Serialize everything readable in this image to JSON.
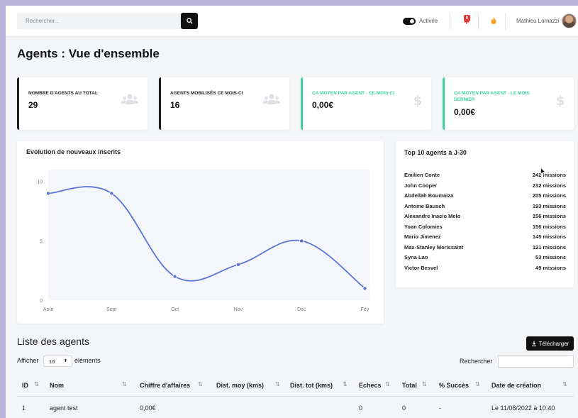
{
  "header": {
    "search_placeholder": "Rechercher...",
    "toggle_label": "Activée",
    "notification_count": "0",
    "user_name": "Mathieu Lomazzi"
  },
  "page": {
    "title": "Agents : Vue d'ensemble"
  },
  "kpis": [
    {
      "label": "Nombre d'agents au total",
      "value": "29"
    },
    {
      "label": "Agents mobilisés ce mois-ci",
      "value": "16"
    },
    {
      "label": "CA moyen par agent - ce mois-ci",
      "value": "0,00€"
    },
    {
      "label": "CA moyen par agent - le mois dernier",
      "value": "0,00€"
    }
  ],
  "chart": {
    "title": "Evolution de nouveaux inscrits"
  },
  "chart_data": {
    "type": "line",
    "title": "Evolution de nouveaux inscrits",
    "xlabel": "",
    "ylabel": "",
    "categories": [
      "Août",
      "Sept",
      "Oct",
      "Nov",
      "Déc",
      "Fév"
    ],
    "series": [
      {
        "values": [
          9,
          9,
          2,
          3,
          5,
          1
        ]
      }
    ],
    "y_ticks": [
      0,
      5,
      10
    ],
    "ylim": [
      0,
      11
    ],
    "grid": false,
    "color": "#5b75d6"
  },
  "top10": {
    "title": "Top 10 agents à J-30",
    "rows": [
      {
        "name": "Emilien Conte",
        "missions": "242 missions"
      },
      {
        "name": "John Cooper",
        "missions": "232 missions"
      },
      {
        "name": "Abdellah Boumaiza",
        "missions": "205 missions"
      },
      {
        "name": "Antoine Bausch",
        "missions": "193 missions"
      },
      {
        "name": "Alexandre Inacio Melo",
        "missions": "156 missions"
      },
      {
        "name": "Yoan Colomies",
        "missions": "156 missions"
      },
      {
        "name": "Mario Jimenez",
        "missions": "145 missions"
      },
      {
        "name": "Max-Stanley Morissaint",
        "missions": "121 missions"
      },
      {
        "name": "Syna Lao",
        "missions": "53 missions"
      },
      {
        "name": "Victor Besvel",
        "missions": "49 missions"
      }
    ]
  },
  "list": {
    "title": "Liste des agents",
    "download_label": "Télécharger",
    "show_label": "Afficher",
    "page_size": "10",
    "elements_label": "éléments",
    "search_label": "Rechercher",
    "columns": [
      "ID",
      "Nom",
      "Chiffre d'affaires",
      "Dist. moy (kms)",
      "Dist. tot (kms)",
      "Echecs",
      "Total",
      "% Succès",
      "Date de création"
    ],
    "rows": [
      {
        "id": "1",
        "nom": "agent test",
        "ca": "0,00€",
        "dist_moy": "",
        "dist_tot": "",
        "echecs": "0",
        "total": "0",
        "succes": "-",
        "date": "Le 11/08/2022 à 10:40"
      }
    ]
  },
  "colors": {
    "accent_green": "#3ed59a",
    "line_blue": "#5b75d6",
    "dark": "#111111",
    "badge_red": "#e23b3b"
  }
}
